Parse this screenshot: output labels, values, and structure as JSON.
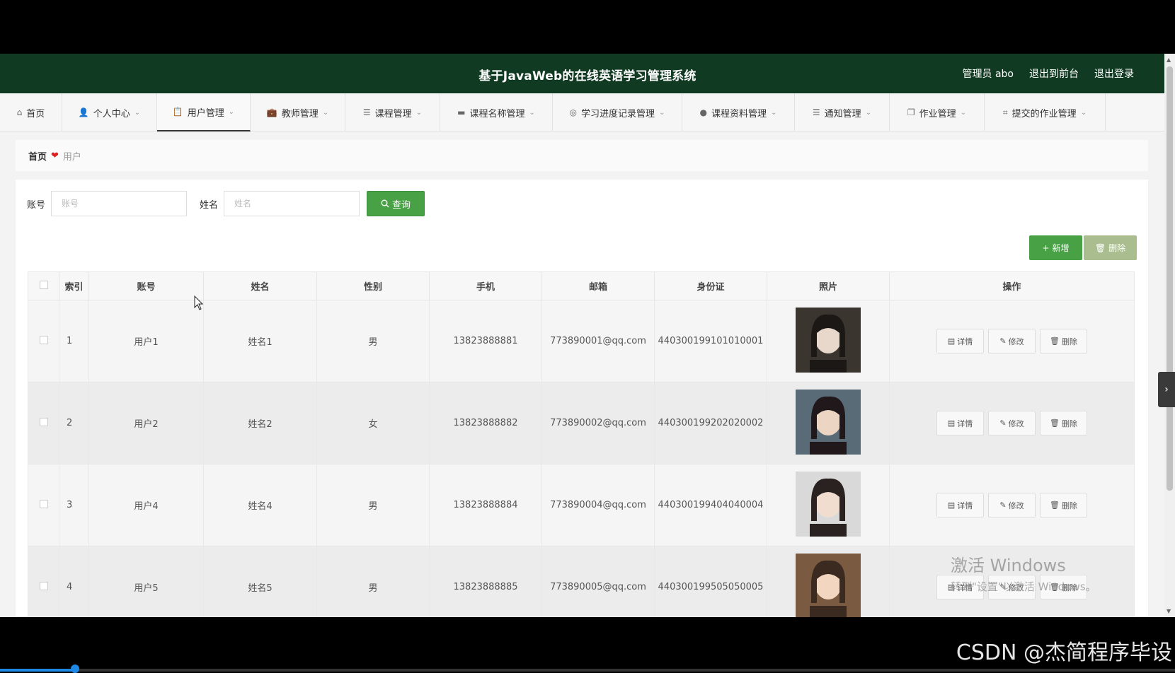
{
  "header": {
    "title": "基于JavaWeb的在线英语学习管理系统",
    "user_label": "管理员 abo",
    "to_front": "退出到前台",
    "logout": "退出登录"
  },
  "nav": [
    {
      "label": "首页",
      "icon": "home-icon",
      "active": false,
      "caret": false
    },
    {
      "label": "个人中心",
      "icon": "user-icon",
      "active": false,
      "caret": true
    },
    {
      "label": "用户管理",
      "icon": "clipboard-icon",
      "active": true,
      "caret": true
    },
    {
      "label": "教师管理",
      "icon": "briefcase-icon",
      "active": false,
      "caret": true
    },
    {
      "label": "课程管理",
      "icon": "list-icon",
      "active": false,
      "caret": true
    },
    {
      "label": "课程名称管理",
      "icon": "monitor-icon",
      "active": false,
      "caret": true
    },
    {
      "label": "学习进度记录管理",
      "icon": "compass-icon",
      "active": false,
      "caret": true
    },
    {
      "label": "课程资料管理",
      "icon": "bulb-icon",
      "active": false,
      "caret": true
    },
    {
      "label": "通知管理",
      "icon": "list-icon",
      "active": false,
      "caret": true
    },
    {
      "label": "作业管理",
      "icon": "copy-icon",
      "active": false,
      "caret": true
    },
    {
      "label": "提交的作业管理",
      "icon": "crop-icon",
      "active": false,
      "caret": true
    }
  ],
  "breadcrumb": {
    "home": "首页",
    "current": "用户"
  },
  "search": {
    "account_label": "账号",
    "account_placeholder": "账号",
    "name_label": "姓名",
    "name_placeholder": "姓名",
    "query_button": "查询"
  },
  "toolbar": {
    "add": "新增",
    "delete": "删除"
  },
  "table": {
    "headers": [
      "索引",
      "账号",
      "姓名",
      "性别",
      "手机",
      "邮箱",
      "身份证",
      "照片",
      "操作"
    ],
    "rows": [
      {
        "index": "1",
        "account": "用户1",
        "name": "姓名1",
        "gender": "男",
        "phone": "13823888881",
        "email": "773890001@qq.com",
        "idcard": "440300199101010001"
      },
      {
        "index": "2",
        "account": "用户2",
        "name": "姓名2",
        "gender": "女",
        "phone": "13823888882",
        "email": "773890002@qq.com",
        "idcard": "440300199202020002"
      },
      {
        "index": "3",
        "account": "用户4",
        "name": "姓名4",
        "gender": "男",
        "phone": "13823888884",
        "email": "773890004@qq.com",
        "idcard": "440300199404040004"
      },
      {
        "index": "4",
        "account": "用户5",
        "name": "姓名5",
        "gender": "男",
        "phone": "13823888885",
        "email": "773890005@qq.com",
        "idcard": "440300199505050005"
      }
    ],
    "ops": {
      "detail": "详情",
      "edit": "修改",
      "delete": "删除"
    }
  },
  "watermark": {
    "line1": "激活 Windows",
    "line2": "转到\"设置\"以激活 Windows。"
  },
  "csdn": "CSDN @杰简程序毕设",
  "colors": {
    "header_bg": "#113a22",
    "primary": "#48a145",
    "danger_light": "#a9bd8f"
  }
}
